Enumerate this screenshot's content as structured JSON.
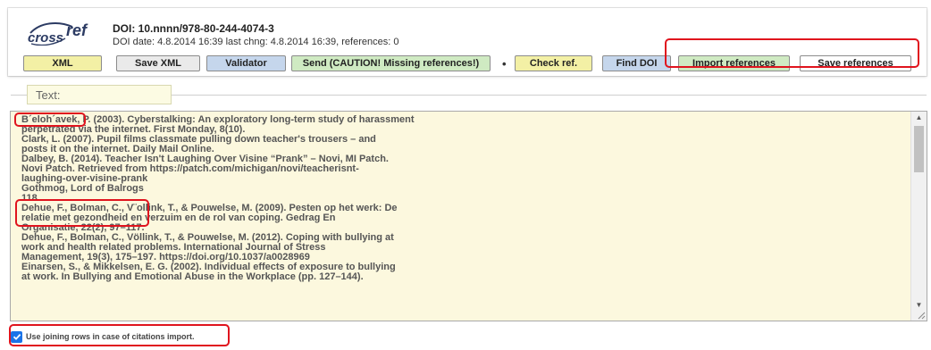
{
  "header": {
    "logo": {
      "part1": "cross",
      "part2": "ref"
    },
    "doi": "DOI: 10.nnnn/978-80-244-4074-3",
    "meta": "DOI date: 4.8.2014 16:39 last chng: 4.8.2014 16:39, references: 0"
  },
  "toolbar": {
    "xml": "XML",
    "save_xml": "Save XML",
    "validator": "Validator",
    "send": "Send (CAUTION! Missing references!)",
    "separator": "•",
    "check_ref": "Check ref.",
    "find_doi": "Find DOI",
    "import_refs": "Import references",
    "save_refs": "Save references"
  },
  "text_section": {
    "label": "Text:",
    "lines": [
      "B´eloh´avek, P. (2003). Cyberstalking: An exploratory long-term study of harassment",
      "perpetrated via the internet. First Monday, 8(10).",
      "Clark, L. (2007). Pupil films classmate pulling down teacher's trousers – and",
      "posts it on the internet. Daily Mail Online.",
      "Dalbey, B. (2014). Teacher Isn't Laughing Over Visine “Prank” – Novi, MI Patch.",
      "Novi Patch. Retrieved from https://patch.com/michigan/novi/teacherisnt-",
      "laughing-over-visine-prank",
      "Gothmog, Lord of Balrogs",
      "118",
      "Dehue, F., Bolman, C., V¨ollink, T., & Pouwelse, M. (2009). Pesten op het werk: De",
      "relatie met gezondheid en verzuim en de rol van coping. Gedrag En",
      "Organisatie, 22(2), 97–117.",
      "Dehue, F., Bolman, C., Völlink, T., & Pouwelse, M. (2012). Coping with bullying at",
      "work and health related problems. International Journal of Stress",
      "Management, 19(3), 175–197. https://doi.org/10.1037/a0028969",
      "Einarsen, S., & Mikkelsen, E. G. (2002). Individual effects of exposure to bullying",
      "at work. In Bullying and Emotional Abuse in the Workplace (pp. 127–144)."
    ]
  },
  "options": {
    "joining_rows": {
      "label": "Use joining rows in case of citations import.",
      "checked": true
    }
  },
  "colors": {
    "highlight": "#e0141e",
    "textarea_bg": "#fcf8de",
    "btn_yellow": "#f3f0a5",
    "btn_blue": "#c5d6ec",
    "btn_green": "#cfeac2",
    "checkbox": "#1a73e8"
  }
}
